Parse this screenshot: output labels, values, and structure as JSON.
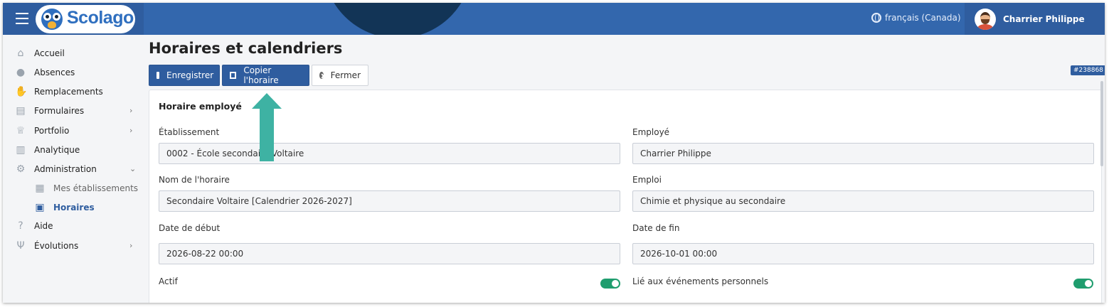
{
  "header": {
    "brand": "Scolago",
    "language": "français (Canada)",
    "user_name": "Charrier Philippe"
  },
  "sidebar": {
    "items": [
      {
        "label": "Accueil",
        "icon": "home-icon"
      },
      {
        "label": "Absences",
        "icon": "user-clock-icon"
      },
      {
        "label": "Remplacements",
        "icon": "handshake-icon"
      },
      {
        "label": "Formulaires",
        "icon": "file-icon"
      },
      {
        "label": "Portfolio",
        "icon": "trophy-icon"
      },
      {
        "label": "Analytique",
        "icon": "chart-file-icon"
      },
      {
        "label": "Administration",
        "icon": "gear-icon"
      },
      {
        "label": "Mes établissements",
        "icon": "school-icon"
      },
      {
        "label": "Horaires",
        "icon": "calendar-icon"
      },
      {
        "label": "Aide",
        "icon": "question-icon"
      },
      {
        "label": "Évolutions",
        "icon": "sprout-icon"
      }
    ]
  },
  "main": {
    "title": "Horaires et calendriers",
    "record_id": "#238868",
    "toolbar": {
      "save_label": "Enregistrer",
      "copy_label": "Copier l'horaire",
      "close_label": "Fermer"
    },
    "card_title": "Horaire employé",
    "fields": {
      "etablissement_label": "Établissement",
      "etablissement_value": "0002 - École secondaire Voltaire",
      "employe_label": "Employé",
      "employe_value": "Charrier Philippe",
      "nom_label": "Nom de l'horaire",
      "nom_value": "Secondaire Voltaire  [Calendrier 2026-2027]",
      "emploi_label": "Emploi",
      "emploi_value": "Chimie et physique au secondaire",
      "debut_label": "Date de début",
      "debut_value": "2026-08-22 00:00",
      "fin_label": "Date de fin",
      "fin_value": "2026-10-01 00:00",
      "actif_label": "Actif",
      "lie_label": "Lié aux événements personnels"
    }
  },
  "colors": {
    "header": "#3367ad",
    "primary": "#2f5d9f",
    "toggle_on": "#1f9d6e",
    "annotation_arrow": "#3eb2a3"
  }
}
